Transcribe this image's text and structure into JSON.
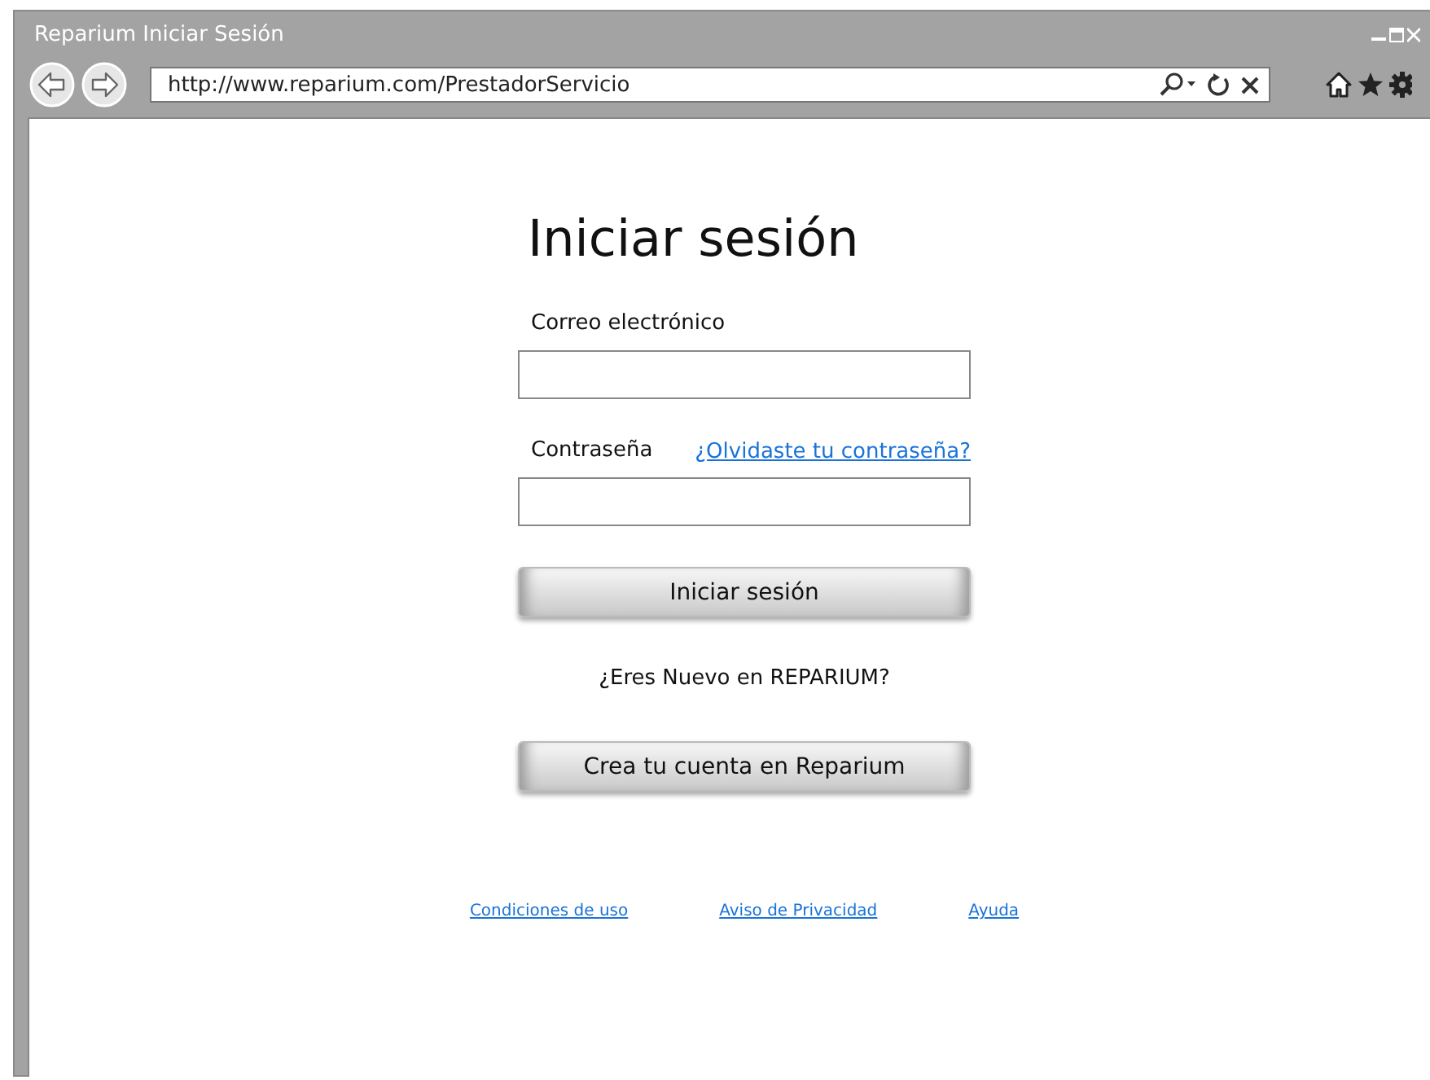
{
  "window": {
    "title": "Reparium Iniciar Sesión"
  },
  "address_bar": {
    "url": "http://www.reparium.com/PrestadorServicio"
  },
  "login": {
    "heading": "Iniciar sesión",
    "email_label": "Correo electrónico",
    "password_label": "Contraseña",
    "forgot_link": "¿Olvidaste tu contraseña?",
    "submit_button": "Iniciar sesión",
    "new_user_text": "¿Eres Nuevo en REPARIUM?",
    "create_account_button": "Crea tu cuenta en Reparium"
  },
  "footer_links": [
    "Condiciones de uso",
    "Aviso de Privacidad",
    "Ayuda"
  ]
}
